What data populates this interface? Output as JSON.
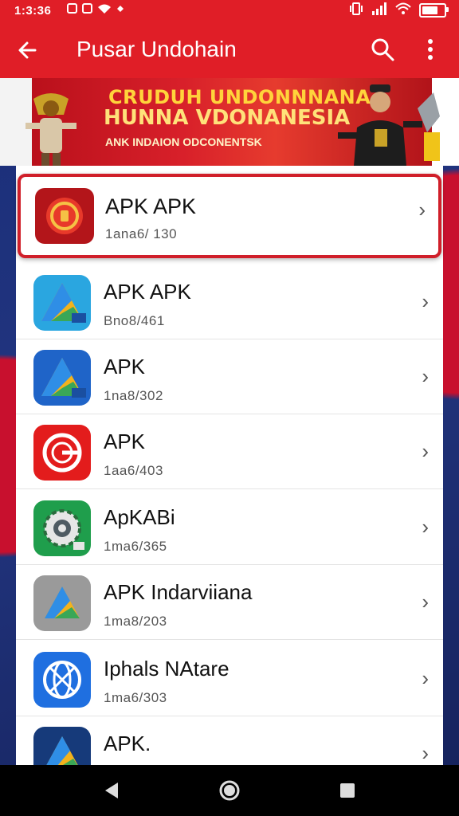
{
  "status_bar": {
    "time": "1:3:36",
    "left_icons": [
      "notification-icon",
      "notification-icon",
      "wifi-icon",
      "pin-icon"
    ],
    "right_icons": [
      "vibrate-icon",
      "signal-icon",
      "wifi-icon",
      "battery-icon"
    ],
    "battery_level": 0.85
  },
  "app_bar": {
    "title": "Pusar Undohain",
    "back_icon": "arrow-left-icon",
    "search_icon": "search-icon",
    "more_icon": "more-vertical-icon"
  },
  "banner": {
    "line1": "CRUDUH UNDONNNANA",
    "line2": "HUNNA VDONANESIA",
    "line3": "ANK INDAION ODCONENTSK"
  },
  "apps": [
    {
      "name": "APK APK",
      "sub": "1ana6/ 130",
      "icon": "red-circle-app-icon",
      "color": "#c9201f"
    },
    {
      "name": "APK APK",
      "sub": "Bno8/461",
      "icon": "triangle-app-icon",
      "color": "#2aa6e0"
    },
    {
      "name": "APK",
      "sub": "1na8/302",
      "icon": "triangle-app-icon",
      "color": "#1f64c8"
    },
    {
      "name": "APK",
      "sub": "1aa6/403",
      "icon": "red-g-app-icon",
      "color": "#e31c1c"
    },
    {
      "name": "ApKABi",
      "sub": "1ma6/365",
      "icon": "green-gear-app-icon",
      "color": "#1f9e4c"
    },
    {
      "name": "APK Indarviiana",
      "sub": "1ma8/203",
      "icon": "gray-triangle-app-icon",
      "color": "#9a9a9a"
    },
    {
      "name": "Iphals NAtare",
      "sub": "1ma6/303",
      "icon": "blue-globe-app-icon",
      "color": "#1f6fe0"
    },
    {
      "name": "APK.",
      "sub": "",
      "icon": "navy-triangle-app-icon",
      "color": "#163a7a"
    }
  ],
  "nav_bar": {
    "back": "back-triangle-icon",
    "home": "home-circle-icon",
    "recents": "recents-square-icon"
  },
  "chevron": "›"
}
